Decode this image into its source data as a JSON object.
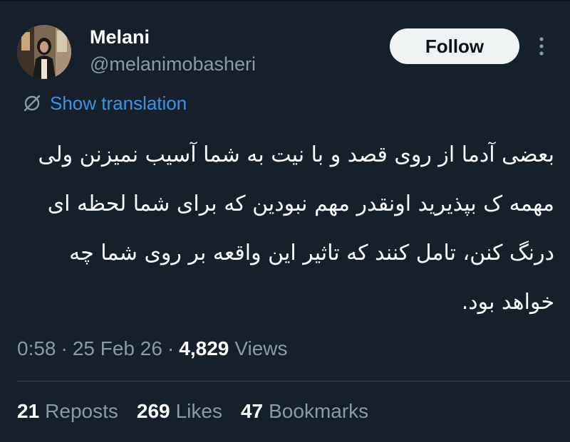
{
  "author": {
    "display_name": "Melani",
    "handle": "@melanimobasheri"
  },
  "follow_label": "Follow",
  "translate_label": "Show translation",
  "tweet": {
    "lines": [
      "بعضی آدما از روی قصد و با نیت به شما آسیب نمیزنن ولی",
      "مهمه ک بپذیرید اونقدر مهم نبودین که برای شما لحظه ای",
      "درنگ کنن، تامل کنند که تاثیر این واقعه بر روی شما چه",
      "خواهد بود."
    ]
  },
  "meta": {
    "time": "0:58",
    "separator": "·",
    "date": "25 Feb 26",
    "views_count": "4,829",
    "views_label": "Views"
  },
  "stats": {
    "reposts_count": "21",
    "reposts_label": "Reposts",
    "likes_count": "269",
    "likes_label": "Likes",
    "bookmarks_count": "47",
    "bookmarks_label": "Bookmarks"
  },
  "colors": {
    "background": "#15202b",
    "primary_text": "#ffffff",
    "secondary_text": "#8b98a5",
    "link": "#3b93e6",
    "follow_button_bg": "#eff3f4"
  },
  "icons": {
    "more": "more-vertical-icon",
    "translate": "translate-icon",
    "avatar": "avatar-photo"
  }
}
